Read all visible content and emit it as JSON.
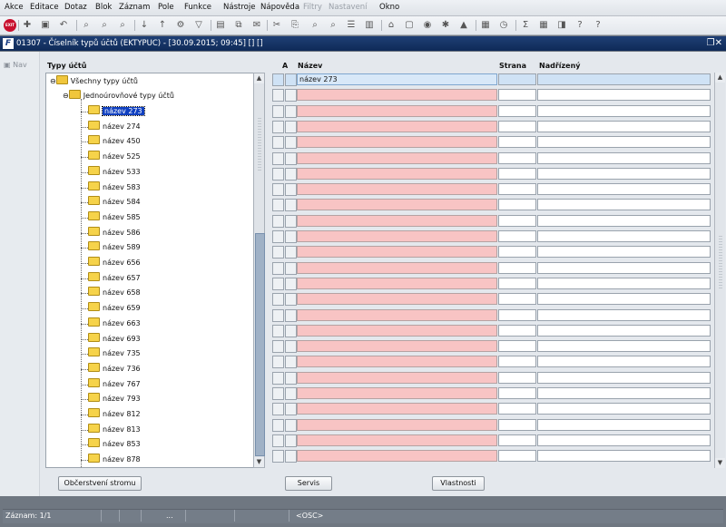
{
  "menu": [
    "Akce",
    "Editace",
    "Dotaz",
    "Blok",
    "Záznam",
    "Pole",
    "Funkce",
    "Nástroje",
    "Nápověda",
    "Filtry",
    "Nastavení",
    "Okno"
  ],
  "menu_disabled": [
    "Filtry",
    "Nastavení"
  ],
  "toolbar": {
    "exit_label": "EXIT",
    "icons": [
      "exit-icon",
      "new-record-icon",
      "save-icon",
      "undo-icon",
      "query-icon",
      "enter-query-icon",
      "execute-query-icon",
      "sort-asc-icon",
      "sort-desc-icon",
      "tools-icon",
      "filter-icon",
      "print-icon",
      "copy-icon",
      "mail-icon",
      "cut-icon",
      "paste-icon",
      "binoculars-icon",
      "find-icon",
      "list-icon",
      "columns-icon",
      "export-icon",
      "document-icon",
      "globe-icon",
      "star-icon",
      "warning-icon",
      "form-icon",
      "clock-icon",
      "sigma-icon",
      "calculator-icon",
      "notes-icon",
      "key-help-icon",
      "help-icon"
    ]
  },
  "window": {
    "title": "01307 - Číselník typů účtů (EKTYPUC) - [30.09.2015; 09:45] [] []",
    "controls": "❐✕"
  },
  "nav": {
    "label": "Nav"
  },
  "tree": {
    "header": "Typy účtů",
    "root": "Všechny typy účtů",
    "child": "Jednoúrovňové typy účtů",
    "items": [
      "název 273",
      "název 274",
      "název 450",
      "název 525",
      "název 533",
      "název 583",
      "název 584",
      "název 585",
      "název 586",
      "název 589",
      "název 656",
      "název 657",
      "název 658",
      "název 659",
      "název 663",
      "název 693",
      "název 735",
      "název 736",
      "název 767",
      "název 793",
      "název 812",
      "název 813",
      "název 853",
      "název 878"
    ],
    "selected": "název 273"
  },
  "grid": {
    "headers": {
      "a": "A",
      "nazev": "Název",
      "strana": "Strana",
      "nadrizeny": "Nadřízený"
    },
    "rows": [
      {
        "nazev": "název 273",
        "strana": "",
        "nadrizeny": ""
      }
    ],
    "empty_row_count": 24
  },
  "buttons": {
    "refresh": "Občerstvení stromu",
    "servis": "Servis",
    "vlastnosti": "Vlastnosti"
  },
  "status": {
    "record": "Záznam: 1/1",
    "ellipsis": "...",
    "osc": "<OSC>"
  }
}
